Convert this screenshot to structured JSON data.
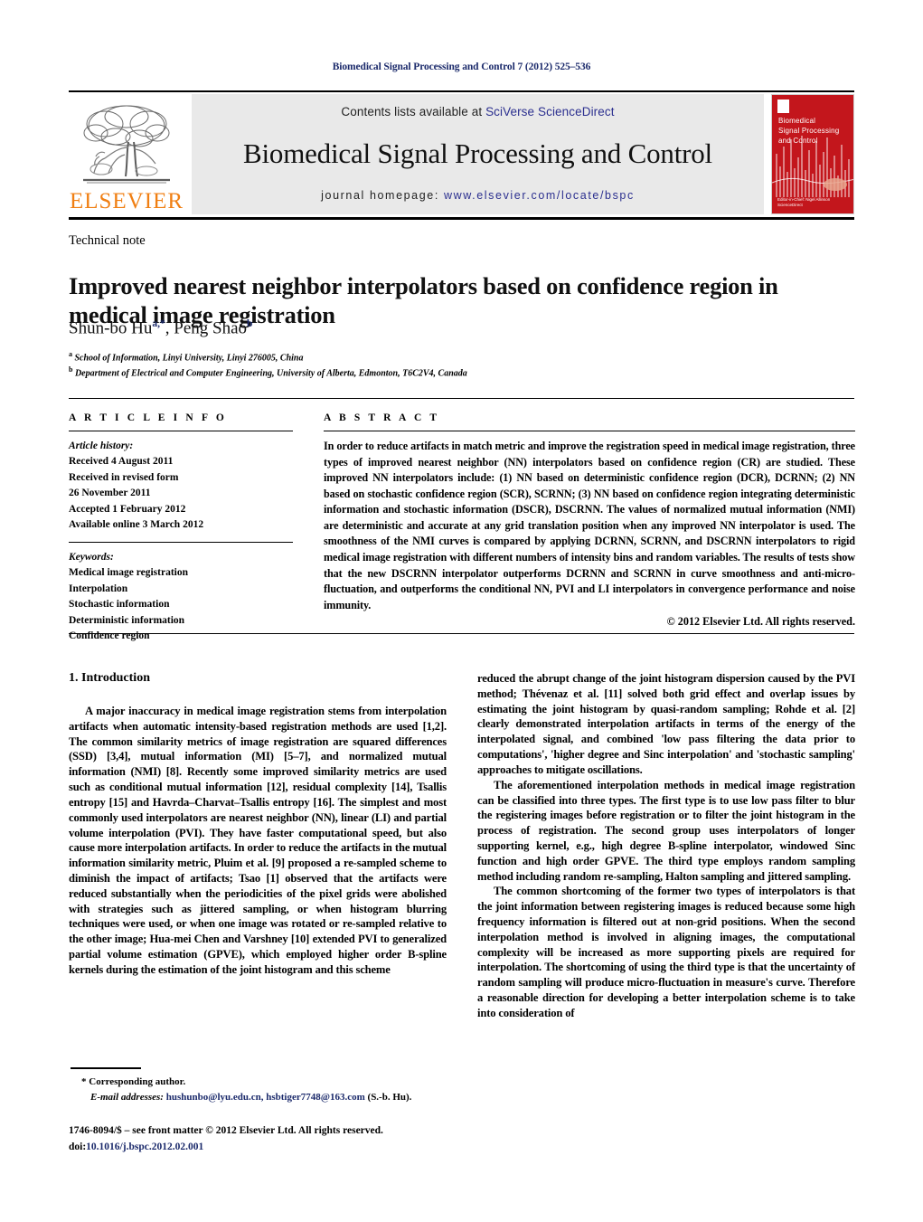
{
  "running_head": "Biomedical Signal Processing and Control 7 (2012) 525–536",
  "masthead": {
    "publisher_name": "ELSEVIER",
    "contents_prefix": "Contents lists available at ",
    "contents_link": "SciVerse ScienceDirect",
    "journal_title": "Biomedical Signal Processing and Control",
    "homepage_prefix": "journal homepage: ",
    "homepage_url": "www.elsevier.com/locate/bspc",
    "cover": {
      "title_line1": "Biomedical",
      "title_line2": "Signal Processing",
      "title_line3": "and Control",
      "foot_line1": "Editor-in-Chief: Nigel Allinson",
      "foot_line2": "ScienceDirect",
      "background_color": "#c3161c"
    }
  },
  "article": {
    "type": "Technical note",
    "title": "Improved nearest neighbor interpolators based on confidence region in medical image registration",
    "authors_html": "Shun-bo Hu<sup>a,*</sup>, Peng Shao<sup>b</sup>",
    "affiliation_a": "School of Information, Linyi University, Linyi 276005, China",
    "affiliation_b": "Department of Electrical and Computer Engineering, University of Alberta, Edmonton, T6C2V4, Canada"
  },
  "article_info": {
    "heading": "A R T I C L E   I N F O",
    "history_label": "Article history:",
    "history": [
      "Received 4 August 2011",
      "Received in revised form",
      "26 November 2011",
      "Accepted 1 February 2012",
      "Available online 3 March 2012"
    ],
    "keywords_label": "Keywords:",
    "keywords": [
      "Medical image registration",
      "Interpolation",
      "Stochastic information",
      "Deterministic information",
      "Confidence region"
    ]
  },
  "abstract": {
    "heading": "A B S T R A C T",
    "text": "In order to reduce artifacts in match metric and improve the registration speed in medical image registration, three types of improved nearest neighbor (NN) interpolators based on confidence region (CR) are studied. These improved NN interpolators include: (1) NN based on deterministic confidence region (DCR), DCRNN; (2) NN based on stochastic confidence region (SCR), SCRNN; (3) NN based on confidence region integrating deterministic information and stochastic information (DSCR), DSCRNN. The values of normalized mutual information (NMI) are deterministic and accurate at any grid translation position when any improved NN interpolator is used. The smoothness of the NMI curves is compared by applying DCRNN, SCRNN, and DSCRNN interpolators to rigid medical image registration with different numbers of intensity bins and random variables. The results of tests show that the new DSCRNN interpolator outperforms DCRNN and SCRNN in curve smoothness and anti-micro-fluctuation, and outperforms the conditional NN, PVI and LI interpolators in convergence performance and noise immunity.",
    "copyright": "© 2012 Elsevier Ltd. All rights reserved."
  },
  "body": {
    "section_number_title": "1.  Introduction",
    "left_paragraphs": [
      "A major inaccuracy in medical image registration stems from interpolation artifacts when automatic intensity-based registration methods are used [1,2]. The common similarity metrics of image registration are squared differences (SSD) [3,4], mutual information (MI) [5–7], and normalized mutual information (NMI) [8]. Recently some improved similarity metrics are used such as conditional mutual information [12], residual complexity [14], Tsallis entropy [15] and Havrda–Charvat–Tsallis entropy [16]. The simplest and most commonly used interpolators are nearest neighbor (NN), linear (LI) and partial volume interpolation (PVI). They have faster computational speed, but also cause more interpolation artifacts. In order to reduce the artifacts in the mutual information similarity metric, Pluim et al. [9] proposed a re-sampled scheme to diminish the impact of artifacts; Tsao [1] observed that the artifacts were reduced substantially when the periodicities of the pixel grids were abolished with strategies such as jittered sampling, or when histogram blurring techniques were used, or when one image was rotated or re-sampled relative to the other image; Hua-mei Chen and Varshney [10] extended PVI to generalized partial volume estimation (GPVE), which employed higher order B-spline kernels during the estimation of the joint histogram and this scheme"
    ],
    "right_paragraphs": [
      "reduced the abrupt change of the joint histogram dispersion caused by the PVI method; Thévenaz et al. [11] solved both grid effect and overlap issues by estimating the joint histogram by quasi-random sampling; Rohde et al. [2] clearly demonstrated interpolation artifacts in terms of the energy of the interpolated signal, and combined 'low pass filtering the data prior to computations', 'higher degree and Sinc interpolation' and 'stochastic sampling' approaches to mitigate oscillations.",
      "The aforementioned interpolation methods in medical image registration can be classified into three types. The first type is to use low pass filter to blur the registering images before registration or to filter the joint histogram in the process of registration. The second group uses interpolators of longer supporting kernel, e.g., high degree B-spline interpolator, windowed Sinc function and high order GPVE. The third type employs random sampling method including random re-sampling, Halton sampling and jittered sampling.",
      "The common shortcoming of the former two types of interpolators is that the joint information between registering images is reduced because some high frequency information is filtered out at non-grid positions. When the second interpolation method is involved in aligning images, the computational complexity will be increased as more supporting pixels are required for interpolation. The shortcoming of using the third type is that the uncertainty of random sampling will produce micro-fluctuation in measure's curve. Therefore a reasonable direction for developing a better interpolation scheme is to take into consideration of"
    ]
  },
  "footnote": {
    "corresponding": "* Corresponding author.",
    "email_label": "E-mail addresses:",
    "emails": "hushunbo@lyu.edu.cn, hsbtiger7748@163.com",
    "email_suffix": " (S.-b. Hu)."
  },
  "issn_line": {
    "front_matter": "1746-8094/$ – see front matter © 2012 Elsevier Ltd. All rights reserved.",
    "doi_label": "doi:",
    "doi": "10.1016/j.bspc.2012.02.001"
  }
}
